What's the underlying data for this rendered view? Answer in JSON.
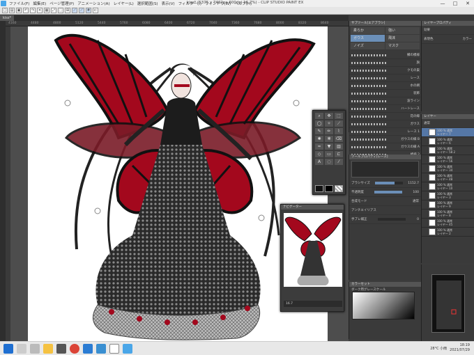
{
  "window": {
    "title": "kiss* (5375 x 7402px 600dpi 16.7%) - CLIP STUDIO PAINT EX",
    "controls": [
      "—",
      "□",
      "✕"
    ]
  },
  "menu": [
    "ファイル(F)",
    "編集(E)",
    "ページ管理(P)",
    "アニメーション(A)",
    "レイヤー(L)",
    "選択範囲(S)",
    "表示(V)",
    "フィルター(I)",
    "ウィンドウ(W)",
    "ヘルプ(H)"
  ],
  "canvas_tab": "kiss*",
  "ruler_ticks": [
    "4160",
    "4480",
    "4800",
    "5120",
    "5440",
    "5760",
    "6080",
    "6400",
    "6720",
    "7040",
    "7360",
    "7680",
    "8000",
    "8320",
    "8640"
  ],
  "subtool": {
    "title": "サブツール[エアブラシ]",
    "items": [
      "柔らか",
      "強い",
      "ガウス",
      "飛沫",
      "ノイズ",
      "マスク"
    ],
    "brushes": [
      "鱗の模様",
      "旗",
      "クモの巣",
      "レース",
      "水の網",
      "装飾",
      "波ライン",
      "ハートレース",
      "花の縁",
      "ガウス",
      "レース 1",
      "ガウスの縁 B",
      "ガウスの縁 A",
      "模様 2"
    ]
  },
  "tool_property": {
    "title": "ツールプロパティ[レース]",
    "rows": [
      {
        "label": "ブラシサイズ",
        "value": "1152.7"
      },
      {
        "label": "不透明度",
        "value": "100"
      },
      {
        "label": "合成モード",
        "value": "通常"
      },
      {
        "label": "アンチエイリアス",
        "value": ""
      },
      {
        "label": "手ブレ補正",
        "value": "0"
      }
    ]
  },
  "color_panel": {
    "title": "カラーセット",
    "set_name": "ダーク用グレースケール"
  },
  "layer_property": {
    "title": "レイヤープロパティ",
    "effect": "効果",
    "expression": "表現色",
    "expression_value": "カラー"
  },
  "layers": {
    "title": "レイヤー",
    "blend": "通常",
    "items": [
      {
        "name": "100 % 通常\nレイヤー 7"
      },
      {
        "name": "100 % 通常\nレイヤー 6"
      },
      {
        "name": "100 % 通常\nレイヤー 58 2"
      },
      {
        "name": "100 % 通常\nレイヤー 56"
      },
      {
        "name": "100 % 通常\nレイヤー 34"
      },
      {
        "name": "100 % 通常\nレイヤー 48"
      },
      {
        "name": "100 % 通常\nレイヤー 10"
      },
      {
        "name": "100 % 通常\nレイヤー 3"
      },
      {
        "name": "100 % 通常\nレイヤー 9"
      },
      {
        "name": "100 % 通常\nレイヤー 8"
      },
      {
        "name": "100 % 通常\nレイヤー 45"
      },
      {
        "name": "100 % 通常\nレイヤー 2"
      }
    ]
  },
  "navigator": {
    "zoom": "16.7",
    "rotation": "0.0"
  },
  "preview": {
    "title": "ナビゲーター",
    "zoom": "16.7"
  },
  "taskbar": {
    "weather": "28°C 小雨",
    "time": "18:19",
    "date": "2021/07/29"
  },
  "colors": {
    "wing_red": "#a3081d",
    "dark": "#1c1c1c",
    "accent": "#6b8fb8"
  }
}
